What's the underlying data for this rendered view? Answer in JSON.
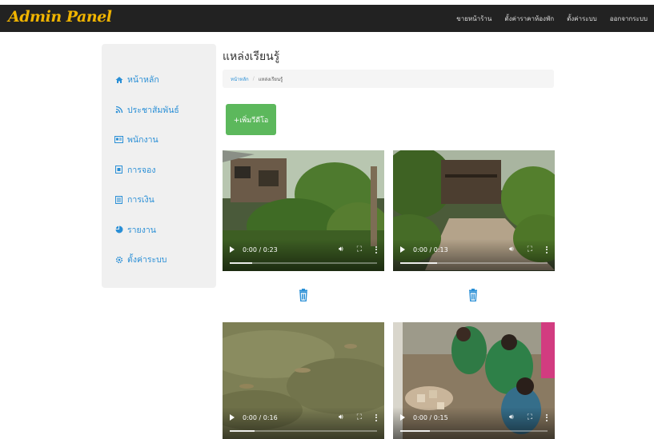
{
  "app": {
    "brand": "Admin Panel",
    "nav": [
      {
        "label": "ขายหน้าร้าน"
      },
      {
        "label": "ตั้งค่าราคาห้องพัก"
      },
      {
        "label": "ตั้งค่าระบบ"
      },
      {
        "label": "ออกจากระบบ"
      }
    ]
  },
  "sidebar": {
    "items": [
      {
        "label": "หน้าหลัก",
        "icon": "home-icon",
        "glyph": "🏠"
      },
      {
        "label": "ประชาสัมพันธ์",
        "icon": "rss-icon",
        "glyph": "☰"
      },
      {
        "label": "พนักงาน",
        "icon": "id-card-icon",
        "glyph": "▣"
      },
      {
        "label": "การจอง",
        "icon": "booking-icon",
        "glyph": "▤"
      },
      {
        "label": "การเงิน",
        "icon": "file-icon",
        "glyph": "▥"
      },
      {
        "label": "รายงาน",
        "icon": "chart-icon",
        "glyph": "◔"
      },
      {
        "label": "ตั้งค่าระบบ",
        "icon": "gear-icon",
        "glyph": "⚙"
      }
    ]
  },
  "main": {
    "title": "แหล่งเรียนรู้",
    "breadcrumb": {
      "home": "หน้าหลัก",
      "separator": "/",
      "current": "แหล่งเรียนรู้"
    },
    "add_button": "+เพิ่มวีดีโอ",
    "videos": [
      {
        "time": "0:00 / 0:23",
        "progress": 0.15
      },
      {
        "time": "0:00 / 0:13",
        "progress": 0.25
      },
      {
        "time": "0:00 / 0:16",
        "progress": 0.17
      },
      {
        "time": "0:00 / 0:15",
        "progress": 0.2
      }
    ]
  },
  "colors": {
    "navbar": "#222222",
    "brand": "#f0b400",
    "accent": "#2a8fd6",
    "add_button": "#5cb85c"
  }
}
